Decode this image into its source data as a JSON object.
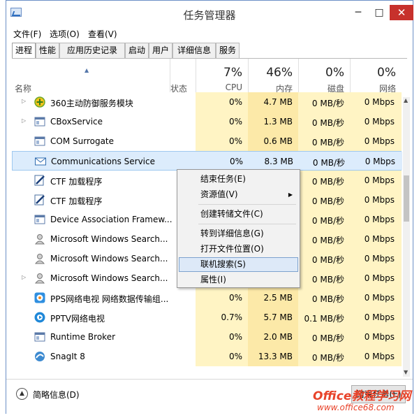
{
  "window": {
    "title": "任务管理器",
    "minimize": "─",
    "maximize": "□",
    "close": "✕"
  },
  "menu": [
    "文件(F)",
    "选项(O)",
    "查看(V)"
  ],
  "tabs": [
    "进程",
    "性能",
    "应用历史记录",
    "启动",
    "用户",
    "详细信息",
    "服务"
  ],
  "header": {
    "name": "名称",
    "status": "状态",
    "cpu_pct": "7%",
    "cpu": "CPU",
    "mem_pct": "46%",
    "mem": "内存",
    "disk_pct": "0%",
    "disk": "磁盘",
    "net_pct": "0%",
    "net": "网络"
  },
  "rows": [
    {
      "name": "360主动防御服务模块",
      "icon": "shield-360-icon",
      "expandable": true,
      "cpu": "0%",
      "mem": "4.7 MB",
      "disk": "0 MB/秒",
      "net": "0 Mbps"
    },
    {
      "name": "CBoxService",
      "icon": "service-window-icon",
      "expandable": true,
      "cpu": "0%",
      "mem": "1.3 MB",
      "disk": "0 MB/秒",
      "net": "0 Mbps"
    },
    {
      "name": "COM Surrogate",
      "icon": "service-window-icon",
      "expandable": false,
      "cpu": "0%",
      "mem": "0.6 MB",
      "disk": "0 MB/秒",
      "net": "0 Mbps"
    },
    {
      "name": "Communications Service",
      "icon": "mail-icon",
      "expandable": false,
      "cpu": "0%",
      "mem": "8.3 MB",
      "disk": "0 MB/秒",
      "net": "0 Mbps",
      "selected": true
    },
    {
      "name": "CTF 加载程序",
      "icon": "pen-edit-icon",
      "expandable": false,
      "cpu": "",
      "mem": "",
      "disk": "0 MB/秒",
      "net": "0 Mbps"
    },
    {
      "name": "CTF 加载程序",
      "icon": "pen-edit-icon",
      "expandable": false,
      "cpu": "",
      "mem": "",
      "disk": "0 MB/秒",
      "net": "0 Mbps"
    },
    {
      "name": "Device Association Framew...",
      "icon": "service-window-icon",
      "expandable": false,
      "cpu": "",
      "mem": "",
      "disk": "0 MB/秒",
      "net": "0 Mbps"
    },
    {
      "name": "Microsoft Windows Search...",
      "icon": "search-user-icon",
      "expandable": false,
      "cpu": "",
      "mem": "",
      "disk": "0 MB/秒",
      "net": "0 Mbps"
    },
    {
      "name": "Microsoft Windows Search...",
      "icon": "search-user-icon",
      "expandable": false,
      "cpu": "",
      "mem": "",
      "disk": "0 MB/秒",
      "net": "0 Mbps"
    },
    {
      "name": "Microsoft Windows Search...",
      "icon": "search-user-icon",
      "expandable": true,
      "cpu": "",
      "mem": "",
      "disk": "0 MB/秒",
      "net": "0 Mbps"
    },
    {
      "name": "PPS网络电视 网络数据传输组...",
      "icon": "pps-icon",
      "expandable": false,
      "cpu": "0%",
      "mem": "2.5 MB",
      "disk": "0 MB/秒",
      "net": "0 Mbps"
    },
    {
      "name": "PPTV网络电视",
      "icon": "pptv-icon",
      "expandable": false,
      "cpu": "0.7%",
      "mem": "5.7 MB",
      "disk": "0.1 MB/秒",
      "net": "0 Mbps"
    },
    {
      "name": "Runtime Broker",
      "icon": "service-window-icon",
      "expandable": false,
      "cpu": "0%",
      "mem": "2.0 MB",
      "disk": "0 MB/秒",
      "net": "0 Mbps"
    },
    {
      "name": "SnagIt 8",
      "icon": "snagit-icon",
      "expandable": false,
      "cpu": "0%",
      "mem": "13.3 MB",
      "disk": "0 MB/秒",
      "net": "0 Mbps"
    }
  ],
  "context_menu": [
    {
      "label": "结束任务(E)"
    },
    {
      "label": "资源值(V)",
      "submenu": true
    },
    {
      "label": "创建转储文件(C)"
    },
    {
      "label": "转到详细信息(G)"
    },
    {
      "label": "打开文件位置(O)"
    },
    {
      "label": "联机搜索(S)",
      "highlighted": true
    },
    {
      "label": "属性(I)"
    }
  ],
  "footer": {
    "collapse": "简略信息(D)",
    "end_task": "结束任务(E)"
  },
  "watermark": {
    "line1": "Office教程学习网",
    "line2": "www.office68.com"
  },
  "colors": {
    "cpu_col": "#fff4c4",
    "mem_col": "#fce9a8",
    "selection": "#dcecfc",
    "close": "#c7312c"
  }
}
